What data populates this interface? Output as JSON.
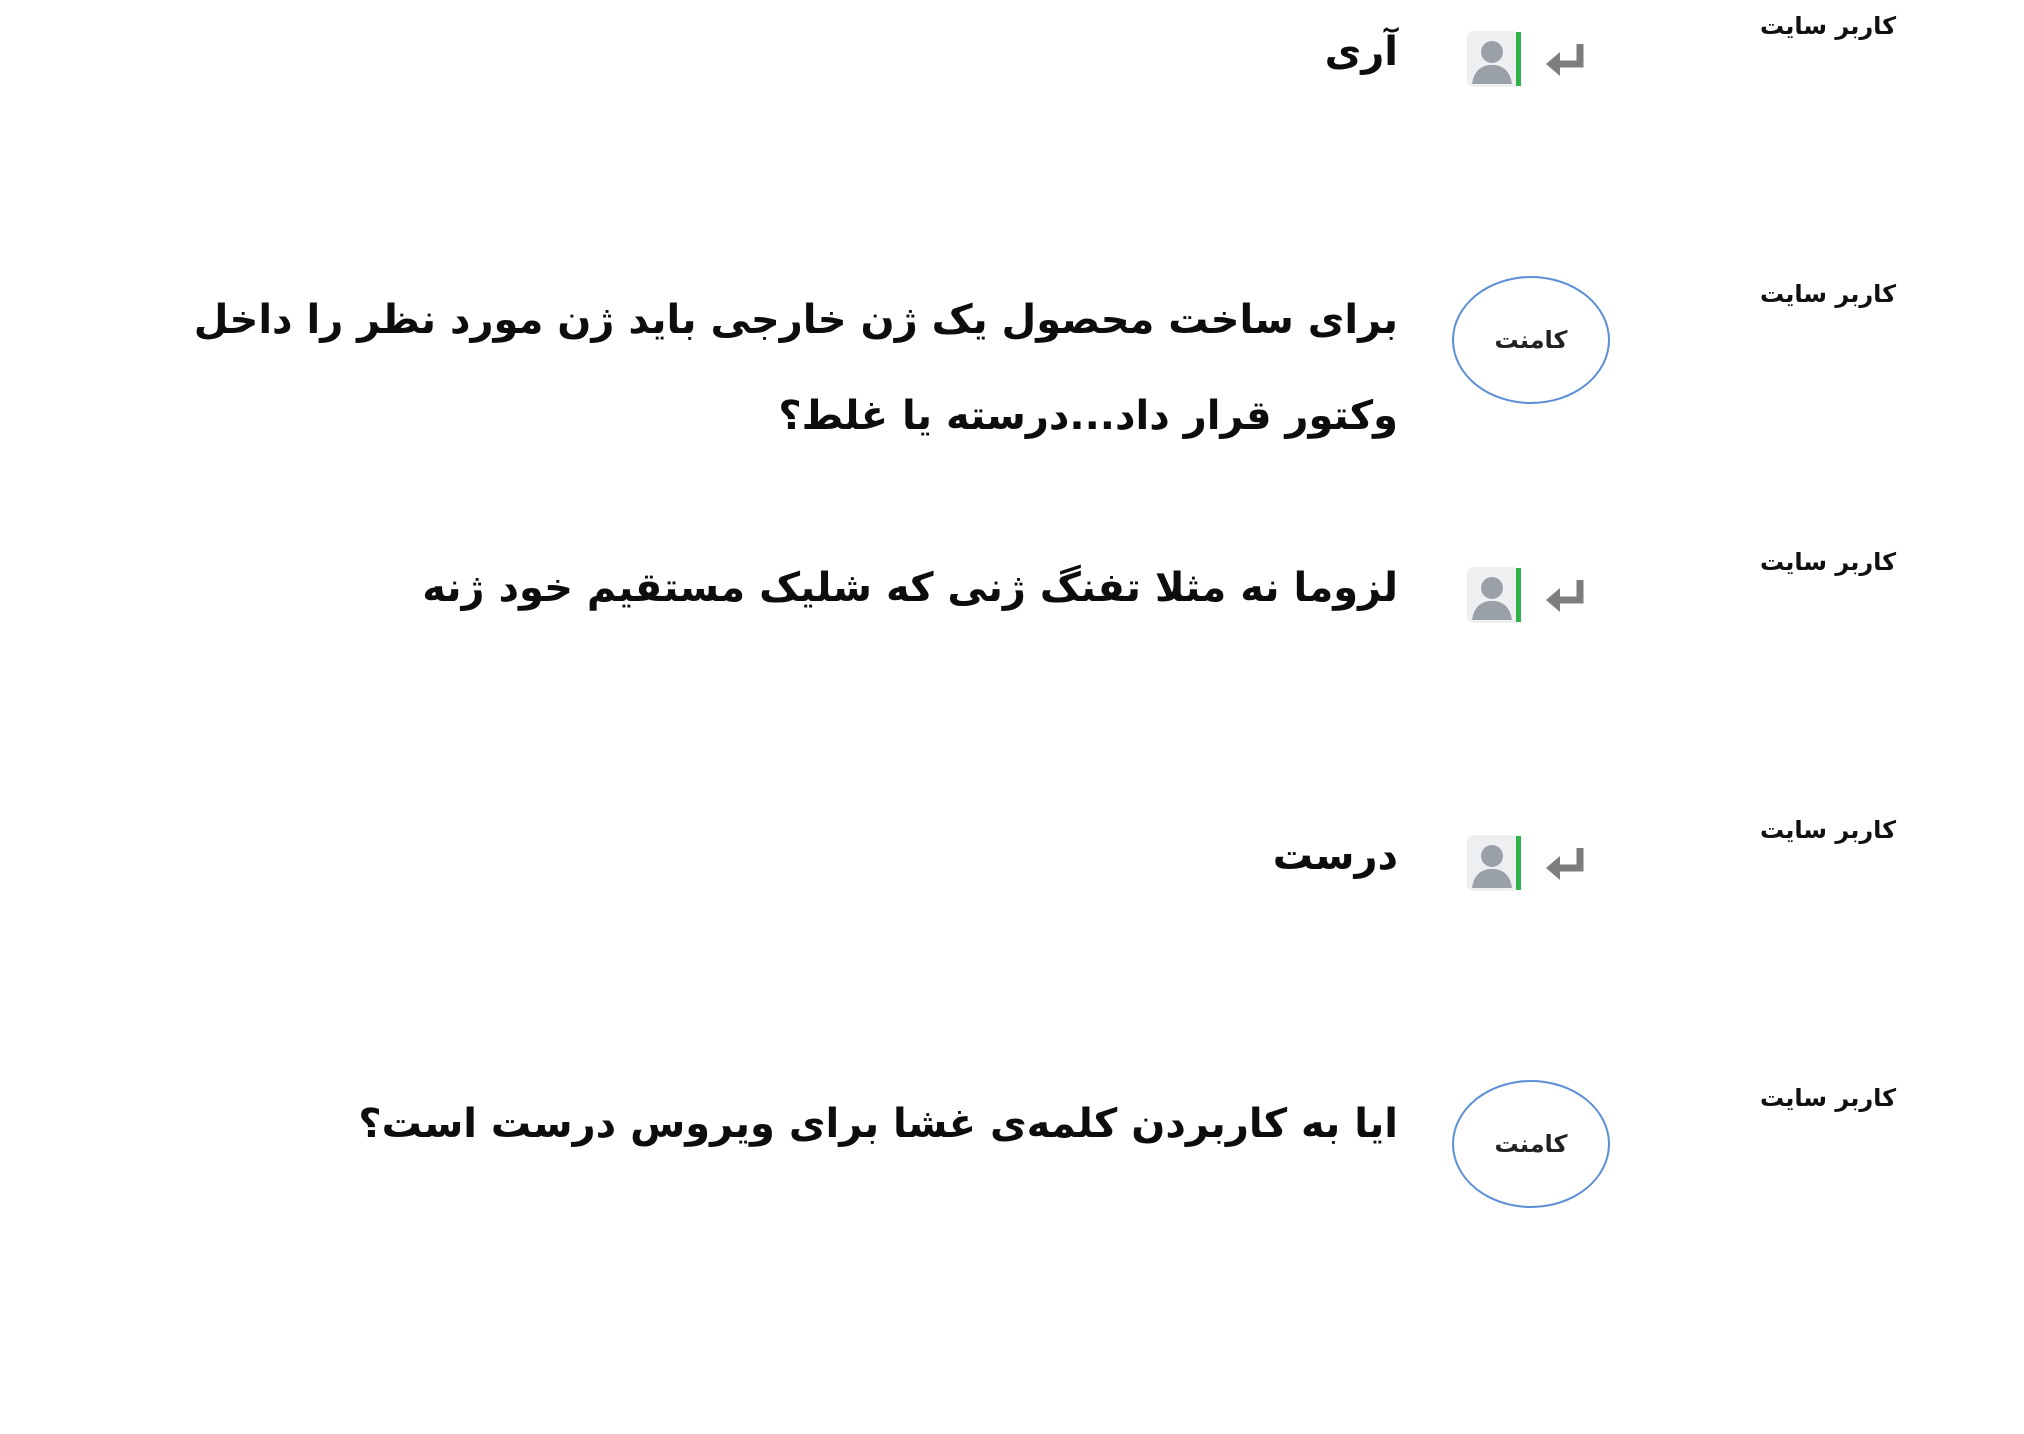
{
  "comments": [
    {
      "author": "کاربر سایت",
      "marker": "reply",
      "text": "آری"
    },
    {
      "author": "کاربر سایت",
      "marker": "comment",
      "marker_label": "کامنت",
      "text": "برای ساخت محصول یک ژن خارجی باید ژن مورد نظر را داخل وکتور قرار داد...درسته یا غلط؟"
    },
    {
      "author": "کاربر سایت",
      "marker": "reply",
      "text": "لزوما نه مثلا تفنگ ژنی که شلیک مستقیم خود ژنه"
    },
    {
      "author": "کاربر سایت",
      "marker": "reply",
      "text": "درست"
    },
    {
      "author": "کاربر سایت",
      "marker": "comment",
      "marker_label": "کامنت",
      "text": "ایا به کاربردن کلمه‌ی غشا برای ویروس درست است؟"
    }
  ],
  "icons": {
    "reply": "reply-arrow-icon",
    "avatar": "user-avatar-icon"
  },
  "colors": {
    "bubble_border": "#5b8fd6",
    "avatar_accent": "#2fb34a",
    "avatar_gray": "#9aa0a8",
    "arrow_gray": "#7d7d7d"
  }
}
